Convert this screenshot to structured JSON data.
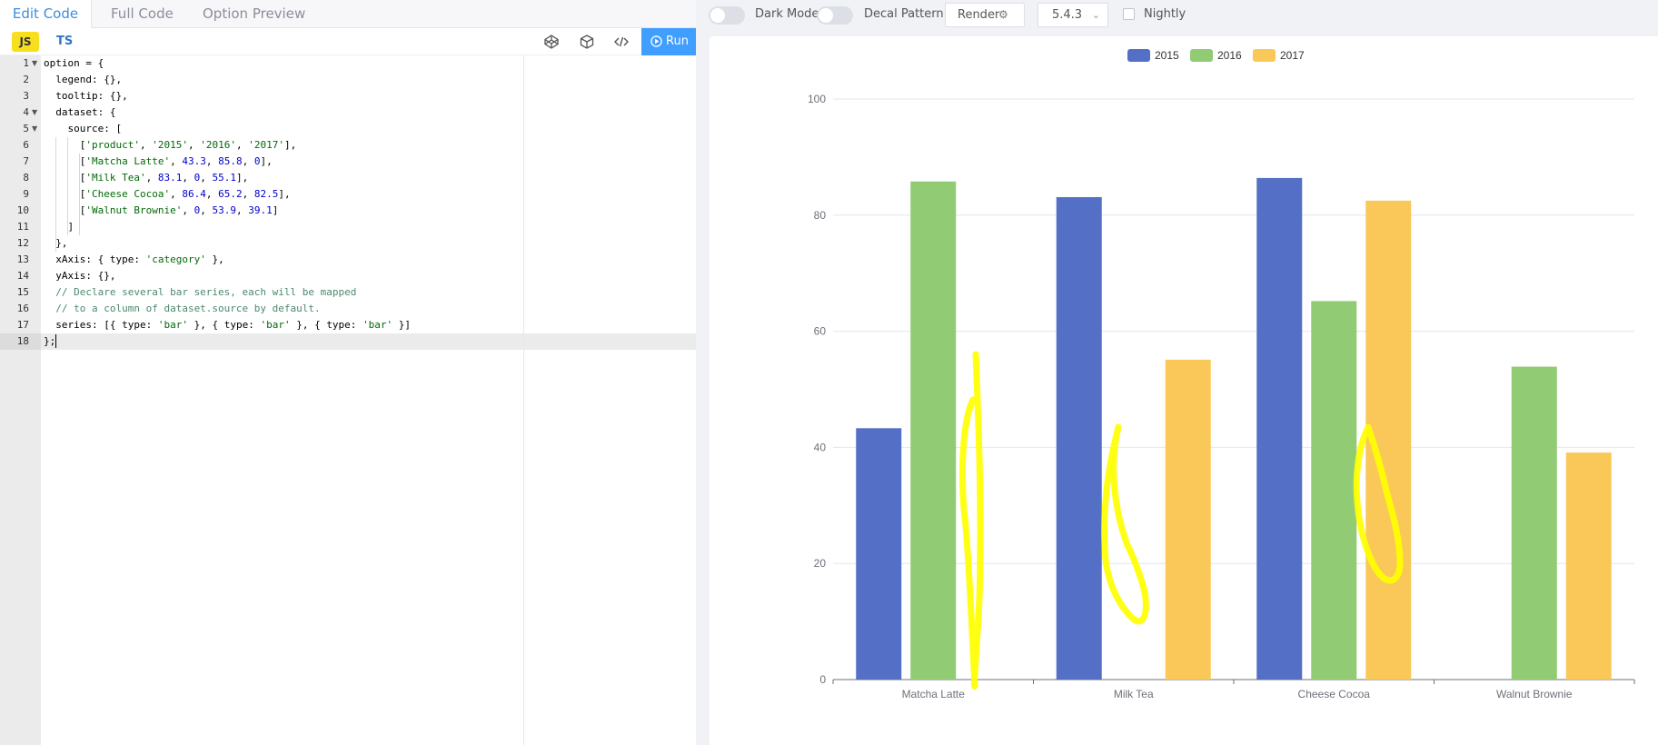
{
  "editor": {
    "tabs": [
      {
        "label": "Edit Code",
        "active": true
      },
      {
        "label": "Full Code",
        "active": false
      },
      {
        "label": "Option Preview",
        "active": false
      }
    ],
    "lang_js": "JS",
    "lang_ts": "TS",
    "run_label": "Run",
    "line_numbers": [
      "1",
      "2",
      "3",
      "4",
      "5",
      "6",
      "7",
      "8",
      "9",
      "10",
      "11",
      "12",
      "13",
      "14",
      "15",
      "16",
      "17",
      "18"
    ],
    "code": [
      [
        [
          "p",
          "option = {"
        ]
      ],
      [
        [
          "p",
          "  legend: {},"
        ]
      ],
      [
        [
          "p",
          "  tooltip: {},"
        ]
      ],
      [
        [
          "p",
          "  dataset: {"
        ]
      ],
      [
        [
          "p",
          "    source: ["
        ]
      ],
      [
        [
          "p",
          "      ["
        ],
        [
          "s",
          "'product'"
        ],
        [
          "p",
          ", "
        ],
        [
          "s",
          "'2015'"
        ],
        [
          "p",
          ", "
        ],
        [
          "s",
          "'2016'"
        ],
        [
          "p",
          ", "
        ],
        [
          "s",
          "'2017'"
        ],
        [
          "p",
          "],"
        ]
      ],
      [
        [
          "p",
          "      ["
        ],
        [
          "s",
          "'Matcha Latte'"
        ],
        [
          "p",
          ", "
        ],
        [
          "n",
          "43.3"
        ],
        [
          "p",
          ", "
        ],
        [
          "n",
          "85.8"
        ],
        [
          "p",
          ", "
        ],
        [
          "n",
          "0"
        ],
        [
          "p",
          "],"
        ]
      ],
      [
        [
          "p",
          "      ["
        ],
        [
          "s",
          "'Milk Tea'"
        ],
        [
          "p",
          ", "
        ],
        [
          "n",
          "83.1"
        ],
        [
          "p",
          ", "
        ],
        [
          "n",
          "0"
        ],
        [
          "p",
          ", "
        ],
        [
          "n",
          "55.1"
        ],
        [
          "p",
          "],"
        ]
      ],
      [
        [
          "p",
          "      ["
        ],
        [
          "s",
          "'Cheese Cocoa'"
        ],
        [
          "p",
          ", "
        ],
        [
          "n",
          "86.4"
        ],
        [
          "p",
          ", "
        ],
        [
          "n",
          "65.2"
        ],
        [
          "p",
          ", "
        ],
        [
          "n",
          "82.5"
        ],
        [
          "p",
          "],"
        ]
      ],
      [
        [
          "p",
          "      ["
        ],
        [
          "s",
          "'Walnut Brownie'"
        ],
        [
          "p",
          ", "
        ],
        [
          "n",
          "0"
        ],
        [
          "p",
          ", "
        ],
        [
          "n",
          "53.9"
        ],
        [
          "p",
          ", "
        ],
        [
          "n",
          "39.1"
        ],
        [
          "p",
          "]"
        ]
      ],
      [
        [
          "p",
          "    ]"
        ]
      ],
      [
        [
          "p",
          "  },"
        ]
      ],
      [
        [
          "p",
          "  xAxis: { type: "
        ],
        [
          "s",
          "'category'"
        ],
        [
          "p",
          " },"
        ]
      ],
      [
        [
          "p",
          "  yAxis: {},"
        ]
      ],
      [
        [
          "c",
          "  // Declare several bar series, each will be mapped"
        ]
      ],
      [
        [
          "c",
          "  // to a column of dataset.source by default."
        ]
      ],
      [
        [
          "p",
          "  series: [{ type: "
        ],
        [
          "s",
          "'bar'"
        ],
        [
          "p",
          " }, { type: "
        ],
        [
          "s",
          "'bar'"
        ],
        [
          "p",
          " }, { type: "
        ],
        [
          "s",
          "'bar'"
        ],
        [
          "p",
          " }]"
        ]
      ],
      [
        [
          "p",
          "};"
        ]
      ]
    ]
  },
  "toolbar": {
    "dark_mode_label": "Dark Mode",
    "decal_label": "Decal Pattern",
    "render_label": "Render",
    "version_label": "5.4.3",
    "nightly_label": "Nightly"
  },
  "chart_data": {
    "type": "bar",
    "categories": [
      "Matcha Latte",
      "Milk Tea",
      "Cheese Cocoa",
      "Walnut Brownie"
    ],
    "series": [
      {
        "name": "2015",
        "color": "#5470c6",
        "values": [
          43.3,
          83.1,
          86.4,
          0
        ]
      },
      {
        "name": "2016",
        "color": "#91cc75",
        "values": [
          85.8,
          0,
          65.2,
          53.9
        ]
      },
      {
        "name": "2017",
        "color": "#fac858",
        "values": [
          0,
          55.1,
          82.5,
          39.1
        ]
      }
    ],
    "ylim": [
      0,
      100
    ],
    "yticks": [
      "0",
      "20",
      "40",
      "60",
      "80",
      "100"
    ],
    "grid": true,
    "legend_position": "top-center"
  },
  "annotation_color": "#ffff00"
}
